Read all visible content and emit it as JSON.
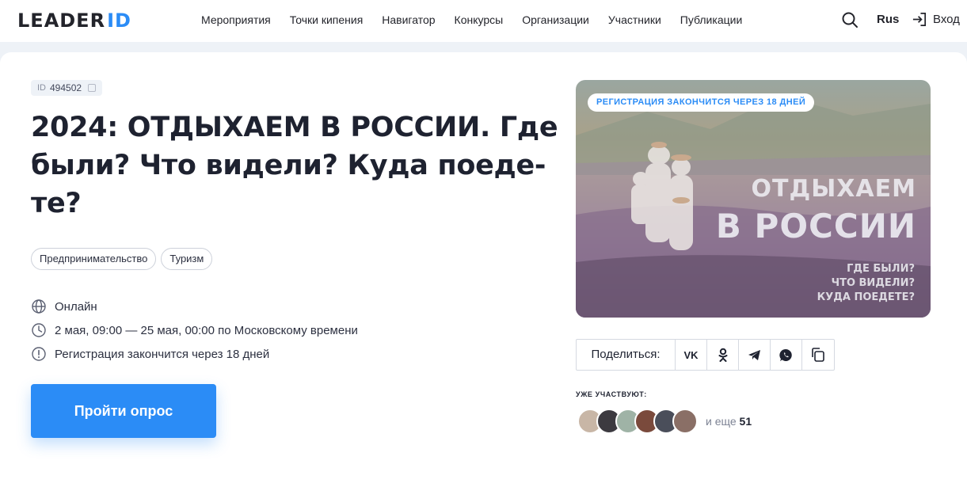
{
  "header": {
    "logo_main": "LEADER",
    "logo_accent": "ID",
    "nav": [
      "Мероприятия",
      "Точки кипения",
      "Навигатор",
      "Конкурсы",
      "Организации",
      "Участники",
      "Публикации"
    ],
    "lang": "Rus",
    "login": "Вход"
  },
  "event": {
    "id_label": "ID",
    "id": "494502",
    "title_lines": [
      "2024: ОТДЫХАЕМ В РОССИИ. Где",
      "были? Что видели? Куда поеде-",
      "те?"
    ],
    "tags": [
      "Предпринимательство",
      "Туризм"
    ],
    "format": "Онлайн",
    "dates": "2 мая, 09:00 — 25 мая, 00:00 по Московскому времени",
    "registration": "Регистрация закончится через 18 дней",
    "cta": "Пройти опрос"
  },
  "poster": {
    "pill": "РЕГИСТРАЦИЯ ЗАКОНЧИТСЯ ЧЕРЕЗ 18 ДНЕЙ",
    "line1": "ОТДЫХАЕМ",
    "line2": "В РОССИИ",
    "sub": [
      "ГДЕ БЫЛИ?",
      "ЧТО ВИДЕЛИ?",
      "КУДА ПОЕДЕТЕ?"
    ]
  },
  "share": {
    "label": "Поделиться:",
    "vk": "VK",
    "icons": [
      "vk-icon",
      "odnoklassniki-icon",
      "telegram-icon",
      "whatsapp-icon",
      "copy-link-icon"
    ]
  },
  "participants": {
    "label": "УЖЕ УЧАСТВУЮТ:",
    "more_prefix": "и еще",
    "more_count": "51",
    "avatar_colors": [
      "#c8b6a6",
      "#3c3a40",
      "#9fb3a6",
      "#7a4a3c",
      "#4a4e5a",
      "#8a6f66"
    ]
  },
  "colors": {
    "accent": "#2b8cf6",
    "text": "#1e2230",
    "background": "#eef2f7"
  }
}
